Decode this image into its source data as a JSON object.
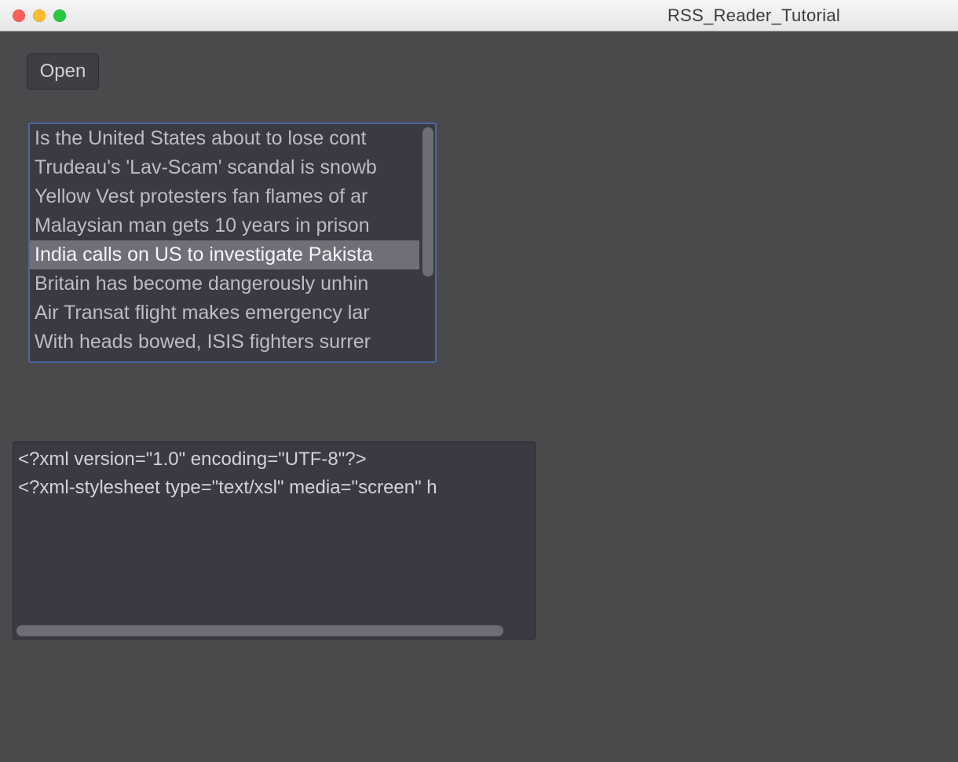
{
  "window": {
    "title": "RSS_Reader_Tutorial"
  },
  "toolbar": {
    "open_label": "Open"
  },
  "headlines": {
    "items": [
      "Is the United States about to lose cont",
      "Trudeau's 'Lav-Scam' scandal is snowb",
      "Yellow Vest protesters fan flames of ar",
      "Malaysian man gets 10 years in prison",
      "India calls on US to investigate Pakista",
      "Britain has become dangerously unhin",
      "Air Transat flight makes emergency lar",
      "With heads bowed, ISIS fighters surrer"
    ],
    "selected_index": 4
  },
  "xml_panel": {
    "line1": "<?xml version=\"1.0\" encoding=\"UTF-8\"?>",
    "line2": "<?xml-stylesheet type=\"text/xsl\" media=\"screen\" h"
  }
}
